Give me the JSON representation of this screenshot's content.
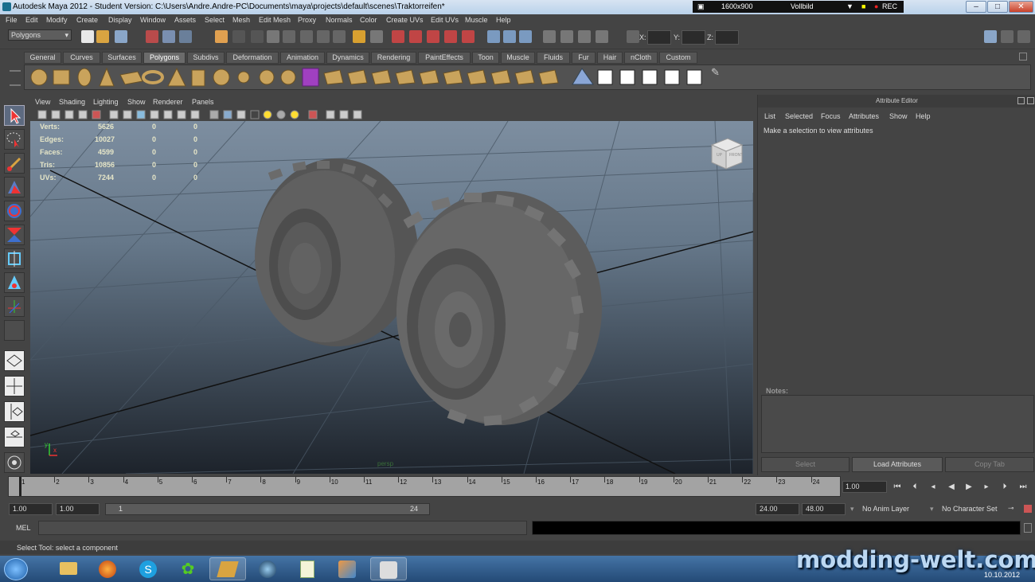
{
  "titlebar": {
    "title": "Autodesk Maya 2012 - Student Version: C:\\Users\\Andre.Andre-PC\\Documents\\maya\\projects\\default\\scenes\\Traktorreifen*",
    "resolution": "1600x900",
    "mode": "Vollbild",
    "rec": "REC"
  },
  "menubar": [
    "File",
    "Edit",
    "Modify",
    "Create",
    "Display",
    "Window",
    "Assets",
    "Select",
    "Mesh",
    "Edit Mesh",
    "Proxy",
    "Normals",
    "Color",
    "Create UVs",
    "Edit UVs",
    "Muscle",
    "Help"
  ],
  "statusline": {
    "menuset": "Polygons",
    "x_label": "X:",
    "y_label": "Y:",
    "z_label": "Z:"
  },
  "shelf": {
    "tabs": [
      "General",
      "Curves",
      "Surfaces",
      "Polygons",
      "Subdivs",
      "Deformation",
      "Animation",
      "Dynamics",
      "Rendering",
      "PaintEffects",
      "Toon",
      "Muscle",
      "Fluids",
      "Fur",
      "Hair",
      "nCloth",
      "Custom"
    ],
    "active": "Polygons"
  },
  "panel_menu": [
    "View",
    "Shading",
    "Lighting",
    "Show",
    "Renderer",
    "Panels"
  ],
  "hud": [
    {
      "label": "Verts:",
      "v1": "5626",
      "v2": "0",
      "v3": "0"
    },
    {
      "label": "Edges:",
      "v1": "10027",
      "v2": "0",
      "v3": "0"
    },
    {
      "label": "Faces:",
      "v1": "4599",
      "v2": "0",
      "v3": "0"
    },
    {
      "label": "Tris:",
      "v1": "10856",
      "v2": "0",
      "v3": "0"
    },
    {
      "label": "UVs:",
      "v1": "7244",
      "v2": "0",
      "v3": "0"
    }
  ],
  "viewcube": {
    "top": "UP",
    "front": "FRONT"
  },
  "camera_label": "persp",
  "attribute_editor": {
    "title": "Attribute Editor",
    "menu": [
      "List",
      "Selected",
      "Focus",
      "Attributes",
      "Show",
      "Help"
    ],
    "message": "Make a selection to view attributes",
    "notes_label": "Notes:",
    "buttons": [
      "Select",
      "Load Attributes",
      "Copy Tab"
    ]
  },
  "timeslider": {
    "ticks": [
      "1",
      "2",
      "3",
      "4",
      "5",
      "6",
      "7",
      "8",
      "9",
      "10",
      "11",
      "12",
      "13",
      "14",
      "15",
      "16",
      "17",
      "18",
      "19",
      "20",
      "21",
      "22",
      "23",
      "24"
    ],
    "current_frame": "1.00"
  },
  "range": {
    "start": "1.00",
    "anim_start": "1.00",
    "range_start": "1",
    "range_end": "24",
    "end": "24.00",
    "anim_end": "48.00",
    "anim_layer": "No Anim Layer",
    "character_set": "No Character Set"
  },
  "cmdline": {
    "label": "MEL"
  },
  "helpline": "Select Tool: select a component",
  "taskbar": {
    "date": "10.10.2012"
  },
  "watermark": "modding-welt.com"
}
